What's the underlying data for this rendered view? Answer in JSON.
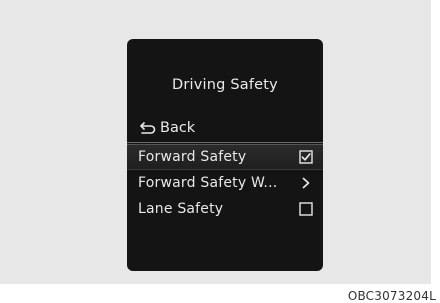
{
  "screen": {
    "title": "Driving Safety",
    "back_label": "Back",
    "menu": [
      {
        "label": "Forward Safety",
        "control": "checkbox",
        "checked": true
      },
      {
        "label": "Forward Safety W...",
        "control": "chevron"
      },
      {
        "label": "Lane Safety",
        "control": "checkbox",
        "checked": false
      }
    ]
  },
  "caption": "OBC3073204L",
  "icons": {
    "back": "return-arrow-icon",
    "checked": "checkbox-checked-icon",
    "unchecked": "checkbox-empty-icon",
    "chevron": "chevron-right-icon"
  }
}
